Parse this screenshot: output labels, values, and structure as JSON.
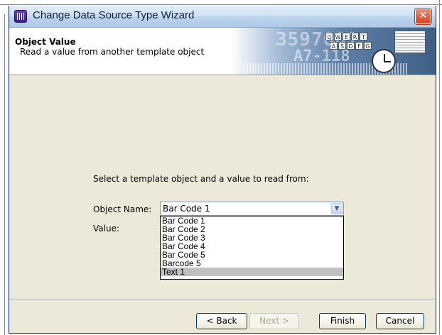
{
  "window": {
    "title": "Change Data Source Type Wizard",
    "close_symbol": "✕"
  },
  "header": {
    "title": "Object Value",
    "subtitle": "Read a value from another template object",
    "banner_number": "3597001",
    "banner_code": "A7-118",
    "keyboard_row1": [
      "Q",
      "W",
      "E",
      "R",
      "T"
    ],
    "keyboard_row2": [
      "A",
      "S",
      "D",
      "F",
      "G"
    ]
  },
  "body": {
    "instruction": "Select a template object and a value to read from:",
    "object_name_label": "Object Name:",
    "value_label": "Value:"
  },
  "combo": {
    "selected": "Bar Code 1",
    "arrow": "▼",
    "options": [
      "Bar Code 1",
      "Bar Code 2",
      "Bar Code 3",
      "Bar Code 4",
      "Bar Code 5",
      "Barcode 5",
      "Text 1"
    ],
    "highlighted_index": 6
  },
  "buttons": {
    "back": "< Back",
    "next": "Next >",
    "finish": "Finish",
    "cancel": "Cancel"
  }
}
